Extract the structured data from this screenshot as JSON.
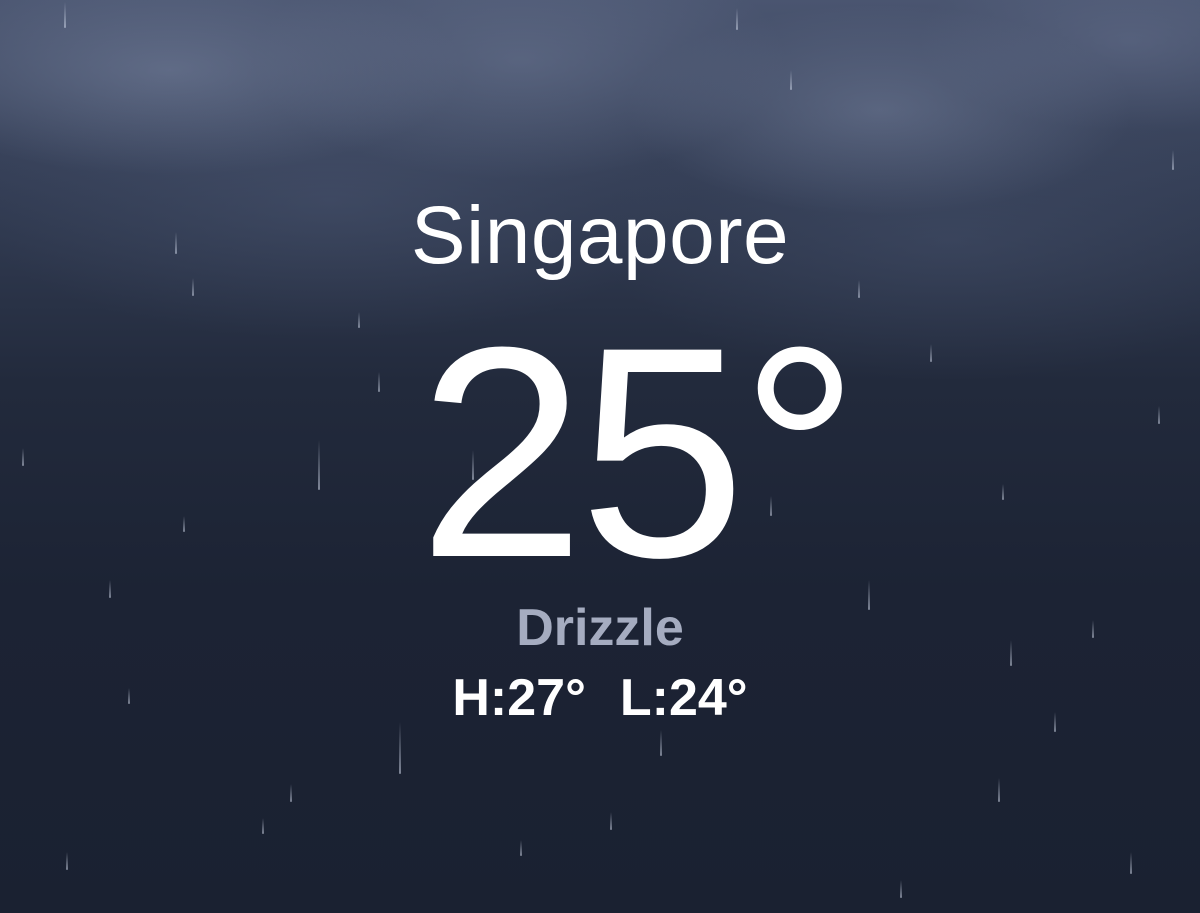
{
  "location": {
    "city": "Singapore"
  },
  "current": {
    "temperature": "25°",
    "condition": "Drizzle",
    "high": "H:27°",
    "low": "L:24°"
  },
  "colors": {
    "background": "#1b2233",
    "clouds": "#6a7591",
    "text_primary": "#ffffff",
    "text_condition": "#a5acc0"
  }
}
